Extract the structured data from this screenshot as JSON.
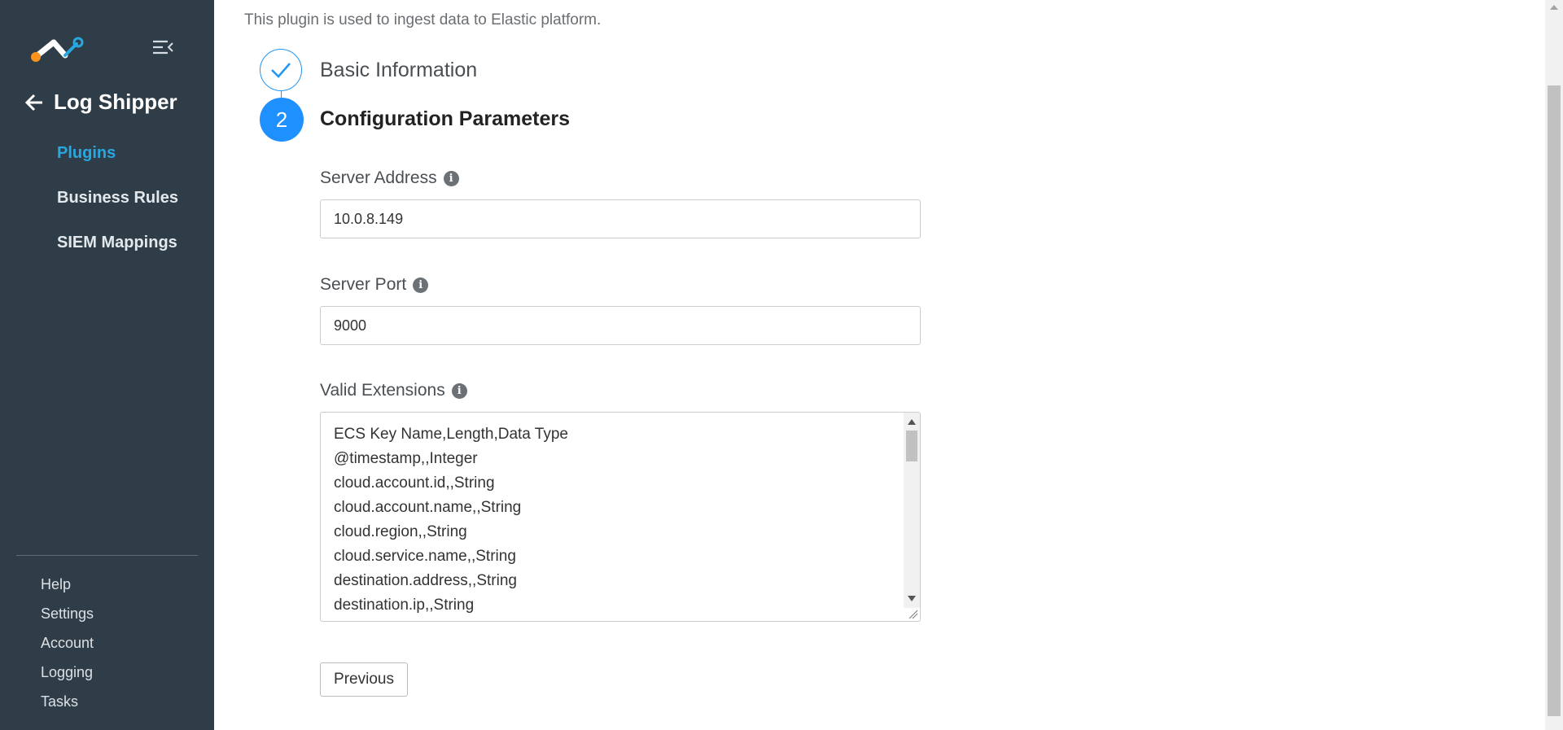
{
  "sidebar": {
    "back_title": "Log Shipper",
    "nav": [
      {
        "label": "Plugins",
        "active": true
      },
      {
        "label": "Business Rules",
        "active": false
      },
      {
        "label": "SIEM Mappings",
        "active": false
      }
    ],
    "footer": [
      "Help",
      "Settings",
      "Account",
      "Logging",
      "Tasks"
    ]
  },
  "main": {
    "description": "This plugin is used to ingest data to Elastic platform.",
    "steps": [
      {
        "number": "",
        "label": "Basic Information",
        "status": "completed"
      },
      {
        "number": "2",
        "label": "Configuration Parameters",
        "status": "active"
      }
    ],
    "fields": {
      "server_address": {
        "label": "Server Address",
        "value": "10.0.8.149"
      },
      "server_port": {
        "label": "Server Port",
        "value": "9000"
      },
      "valid_extensions": {
        "label": "Valid Extensions",
        "lines": [
          "ECS Key Name,Length,Data Type",
          "@timestamp,,Integer",
          "cloud.account.id,,String",
          "cloud.account.name,,String",
          "cloud.region,,String",
          "cloud.service.name,,String",
          "destination.address,,String",
          "destination.ip,,String"
        ]
      }
    },
    "previous_label": "Previous"
  },
  "colors": {
    "sidebar_bg": "#2e3d47",
    "accent": "#29a7e1",
    "step_blue": "#1e90ff"
  },
  "icons": [
    "app-logo",
    "collapse-menu-icon",
    "back-arrow-icon",
    "checkmark-icon",
    "info-icon"
  ]
}
